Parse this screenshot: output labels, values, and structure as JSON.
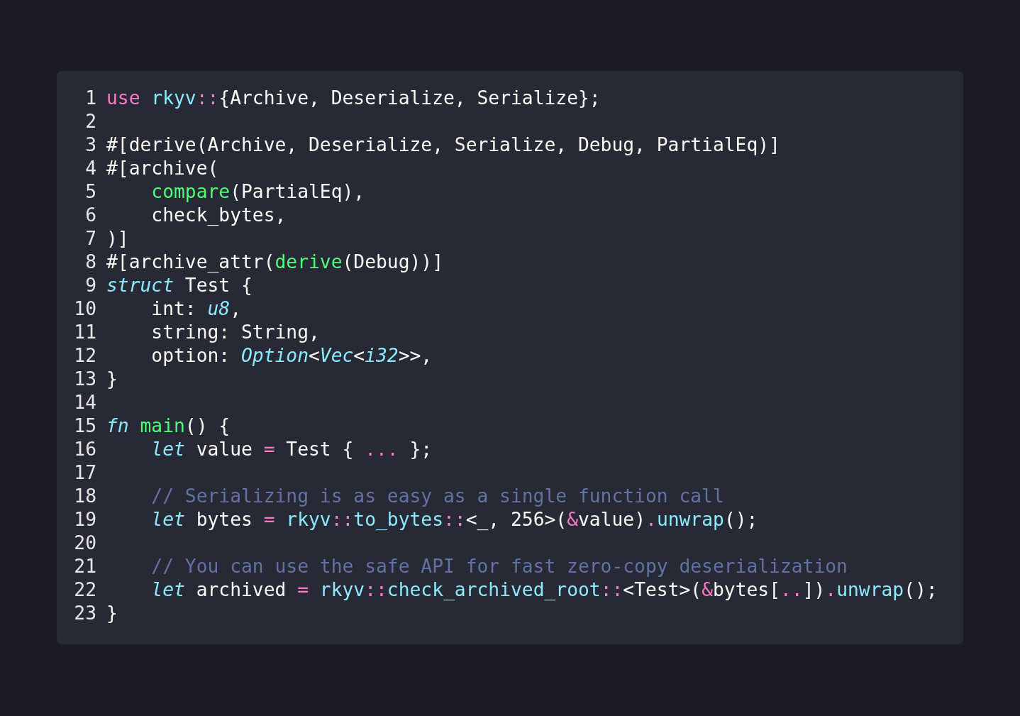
{
  "code_block": {
    "lines": [
      {
        "number": "1",
        "tokens": [
          {
            "kind": "keyword",
            "text": "use "
          },
          {
            "kind": "namespace",
            "text": "rkyv"
          },
          {
            "kind": "operator",
            "text": "::"
          },
          {
            "kind": "text",
            "text": "{Archive, Deserialize, Serialize};"
          }
        ]
      },
      {
        "number": "2"
      },
      {
        "number": "3",
        "tokens": [
          {
            "kind": "text",
            "text": "#[derive(Archive, Deserialize, Serialize, Debug, PartialEq)]"
          }
        ]
      },
      {
        "number": "4",
        "tokens": [
          {
            "kind": "text",
            "text": "#[archive("
          }
        ]
      },
      {
        "number": "5",
        "indented": true,
        "tokens": [
          {
            "kind": "function",
            "text": "compare"
          },
          {
            "kind": "text",
            "text": "(PartialEq),"
          }
        ]
      },
      {
        "number": "6",
        "indented": true,
        "tokens": [
          {
            "kind": "text",
            "text": "check_bytes,"
          }
        ]
      },
      {
        "number": "7",
        "tokens": [
          {
            "kind": "text",
            "text": ")]"
          }
        ]
      },
      {
        "number": "8",
        "tokens": [
          {
            "kind": "text",
            "text": "#[archive_attr("
          },
          {
            "kind": "function",
            "text": "derive"
          },
          {
            "kind": "text",
            "text": "(Debug))]"
          }
        ]
      },
      {
        "number": "9",
        "tokens": [
          {
            "kind": "storage",
            "text": "struct"
          },
          {
            "kind": "text",
            "text": " Test {"
          }
        ]
      },
      {
        "number": "10",
        "indented": true,
        "tokens": [
          {
            "kind": "text",
            "text": "int: "
          },
          {
            "kind": "type",
            "text": "u8"
          },
          {
            "kind": "text",
            "text": ","
          }
        ]
      },
      {
        "number": "11",
        "indented": true,
        "tokens": [
          {
            "kind": "text",
            "text": "string: String,"
          }
        ]
      },
      {
        "number": "12",
        "indented": true,
        "tokens": [
          {
            "kind": "text",
            "text": "option: "
          },
          {
            "kind": "type",
            "text": "Option"
          },
          {
            "kind": "text",
            "text": "<"
          },
          {
            "kind": "type",
            "text": "Vec"
          },
          {
            "kind": "text",
            "text": "<"
          },
          {
            "kind": "type",
            "text": "i32"
          },
          {
            "kind": "text",
            "text": ">>,"
          }
        ]
      },
      {
        "number": "13",
        "tokens": [
          {
            "kind": "text",
            "text": "}"
          }
        ]
      },
      {
        "number": "14"
      },
      {
        "number": "15",
        "tokens": [
          {
            "kind": "storage",
            "text": "fn "
          },
          {
            "kind": "function",
            "text": "main"
          },
          {
            "kind": "text",
            "text": "() {"
          }
        ]
      },
      {
        "number": "16",
        "indented": true,
        "tokens": [
          {
            "kind": "storage",
            "text": "let"
          },
          {
            "kind": "text",
            "text": " value "
          },
          {
            "kind": "operator",
            "text": "="
          },
          {
            "kind": "text",
            "text": " Test { "
          },
          {
            "kind": "operator",
            "text": "..."
          },
          {
            "kind": "text",
            "text": " };"
          }
        ]
      },
      {
        "number": "17"
      },
      {
        "number": "18",
        "indented": true,
        "tokens": [
          {
            "kind": "comment",
            "text": "// Serializing is as easy as a single function call"
          }
        ]
      },
      {
        "number": "19",
        "indented": true,
        "tokens": [
          {
            "kind": "storage",
            "text": "let"
          },
          {
            "kind": "text",
            "text": " bytes "
          },
          {
            "kind": "operator",
            "text": "= "
          },
          {
            "kind": "namespace",
            "text": "rkyv"
          },
          {
            "kind": "operator",
            "text": "::"
          },
          {
            "kind": "namespace",
            "text": "to_bytes"
          },
          {
            "kind": "operator",
            "text": "::"
          },
          {
            "kind": "text",
            "text": "<_, 256>("
          },
          {
            "kind": "operator",
            "text": "&"
          },
          {
            "kind": "text",
            "text": "value)"
          },
          {
            "kind": "operator",
            "text": "."
          },
          {
            "kind": "namespace",
            "text": "unwrap"
          },
          {
            "kind": "text",
            "text": "();"
          }
        ]
      },
      {
        "number": "20"
      },
      {
        "number": "21",
        "indented": true,
        "tokens": [
          {
            "kind": "comment",
            "text": "// You can use the safe API for fast zero-copy deserialization"
          }
        ]
      },
      {
        "number": "22",
        "indented": true,
        "tokens": [
          {
            "kind": "storage",
            "text": "let"
          },
          {
            "kind": "text",
            "text": " archived "
          },
          {
            "kind": "operator",
            "text": "= "
          },
          {
            "kind": "namespace",
            "text": "rkyv"
          },
          {
            "kind": "operator",
            "text": "::"
          },
          {
            "kind": "namespace",
            "text": "check_archived_root"
          },
          {
            "kind": "operator",
            "text": "::"
          },
          {
            "kind": "text",
            "text": "<Test>("
          },
          {
            "kind": "operator",
            "text": "&"
          },
          {
            "kind": "text",
            "text": "bytes["
          },
          {
            "kind": "operator",
            "text": ".."
          },
          {
            "kind": "text",
            "text": "])"
          },
          {
            "kind": "operator",
            "text": "."
          },
          {
            "kind": "namespace",
            "text": "unwrap"
          },
          {
            "kind": "text",
            "text": "();"
          }
        ]
      },
      {
        "number": "23",
        "tokens": [
          {
            "kind": "text",
            "text": "}"
          }
        ]
      }
    ]
  }
}
